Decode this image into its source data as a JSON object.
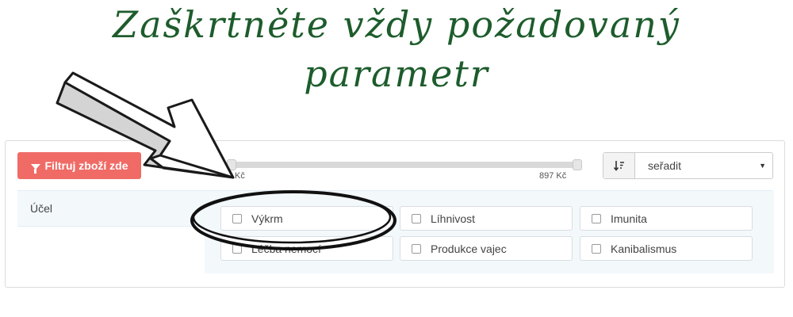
{
  "headline": {
    "line1": "Zaškrtněte vždy požadovaný",
    "line2": "parametr"
  },
  "filter_button": {
    "label": "Filtruj zboží zde",
    "icon": "filter-icon"
  },
  "price_slider": {
    "min_label": "Kč",
    "max_label": "897 Kč"
  },
  "sort": {
    "icon": "sort-icon",
    "selected": "seřadit"
  },
  "section": {
    "label": "Účel",
    "options": [
      {
        "label": "Výkrm",
        "checked": false
      },
      {
        "label": "Líhnivost",
        "checked": false
      },
      {
        "label": "Imunita",
        "checked": false
      },
      {
        "label": "Léčba nemocí",
        "checked": false
      },
      {
        "label": "Produkce vajec",
        "checked": false
      },
      {
        "label": "Kanibalismus",
        "checked": false
      }
    ]
  },
  "colors": {
    "headline": "#1d5c2c",
    "button": "#f06b66",
    "section_bg": "#f3f8fb"
  }
}
